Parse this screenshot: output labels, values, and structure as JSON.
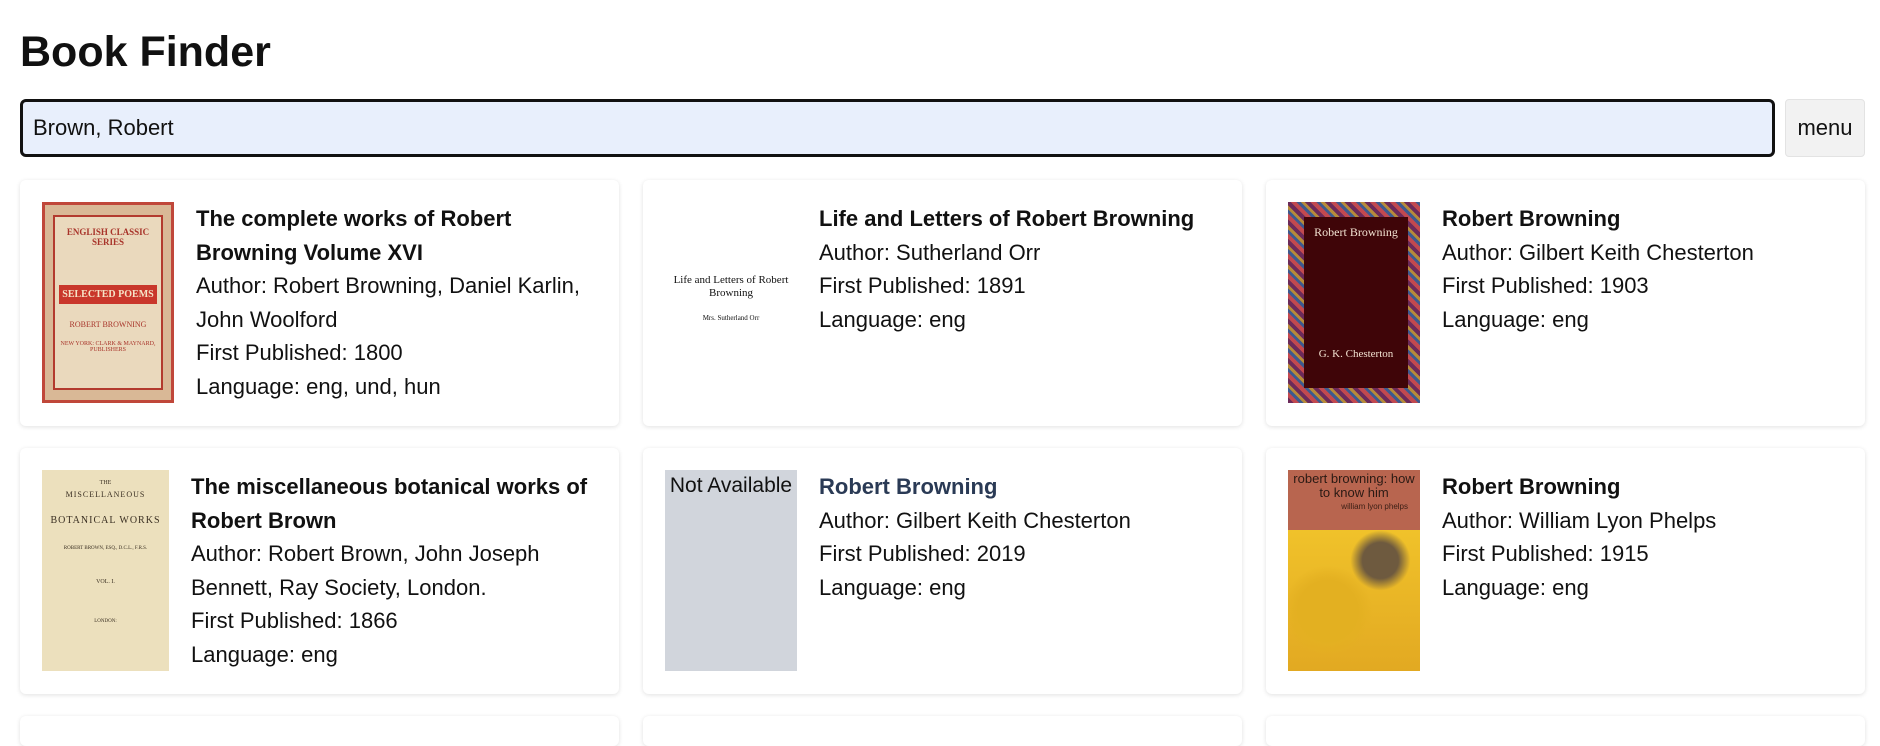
{
  "header": {
    "title": "Book Finder"
  },
  "search": {
    "value": "Brown, Robert",
    "menu_label": "menu"
  },
  "results": [
    {
      "title": "The complete works of Robert Browning Volume XVI",
      "author": "Author: Robert Browning, Daniel Karlin, John Woolford",
      "published": "First Published: 1800",
      "language": "Language: eng, und, hun",
      "cover": {
        "line1": "ENGLISH CLASSIC SERIES",
        "band": "SELECTED POEMS",
        "line2": "ROBERT BROWNING",
        "line3": "NEW YORK: CLARK & MAYNARD, PUBLISHERS"
      }
    },
    {
      "title": "Life and Letters of Robert Browning",
      "author": "Author: Sutherland Orr",
      "published": "First Published: 1891",
      "language": "Language: eng",
      "cover": {
        "line1": "Life and Letters of Robert Browning",
        "line2": "Mrs. Sutherland Orr"
      }
    },
    {
      "title": "Robert Browning",
      "author": "Author: Gilbert Keith Chesterton",
      "published": "First Published: 1903",
      "language": "Language: eng",
      "cover": {
        "line1": "Robert Browning",
        "line2": "G. K. Chesterton"
      }
    },
    {
      "title": "The miscellaneous botanical works of Robert Brown",
      "author": "Author: Robert Brown, John Joseph Bennett, Ray Society, London.",
      "published": "First Published: 1866",
      "language": "Language: eng",
      "cover": {
        "line1": "THE",
        "line2": "MISCELLANEOUS",
        "line3": "BOTANICAL WORKS",
        "line4": "ROBERT BROWN, ESQ., D.C.L., F.R.S.",
        "line5": "VOL. I.",
        "line6": "LONDON:"
      }
    },
    {
      "title": "Robert Browning",
      "author": "Author: Gilbert Keith Chesterton",
      "published": "First Published: 2019",
      "language": "Language: eng",
      "cover": {
        "placeholder": "Not Available"
      }
    },
    {
      "title": "Robert Browning",
      "author": "Author: William Lyon Phelps",
      "published": "First Published: 1915",
      "language": "Language: eng",
      "cover": {
        "line1": "robert browning: how to know him",
        "line2": "william lyon phelps"
      }
    }
  ]
}
